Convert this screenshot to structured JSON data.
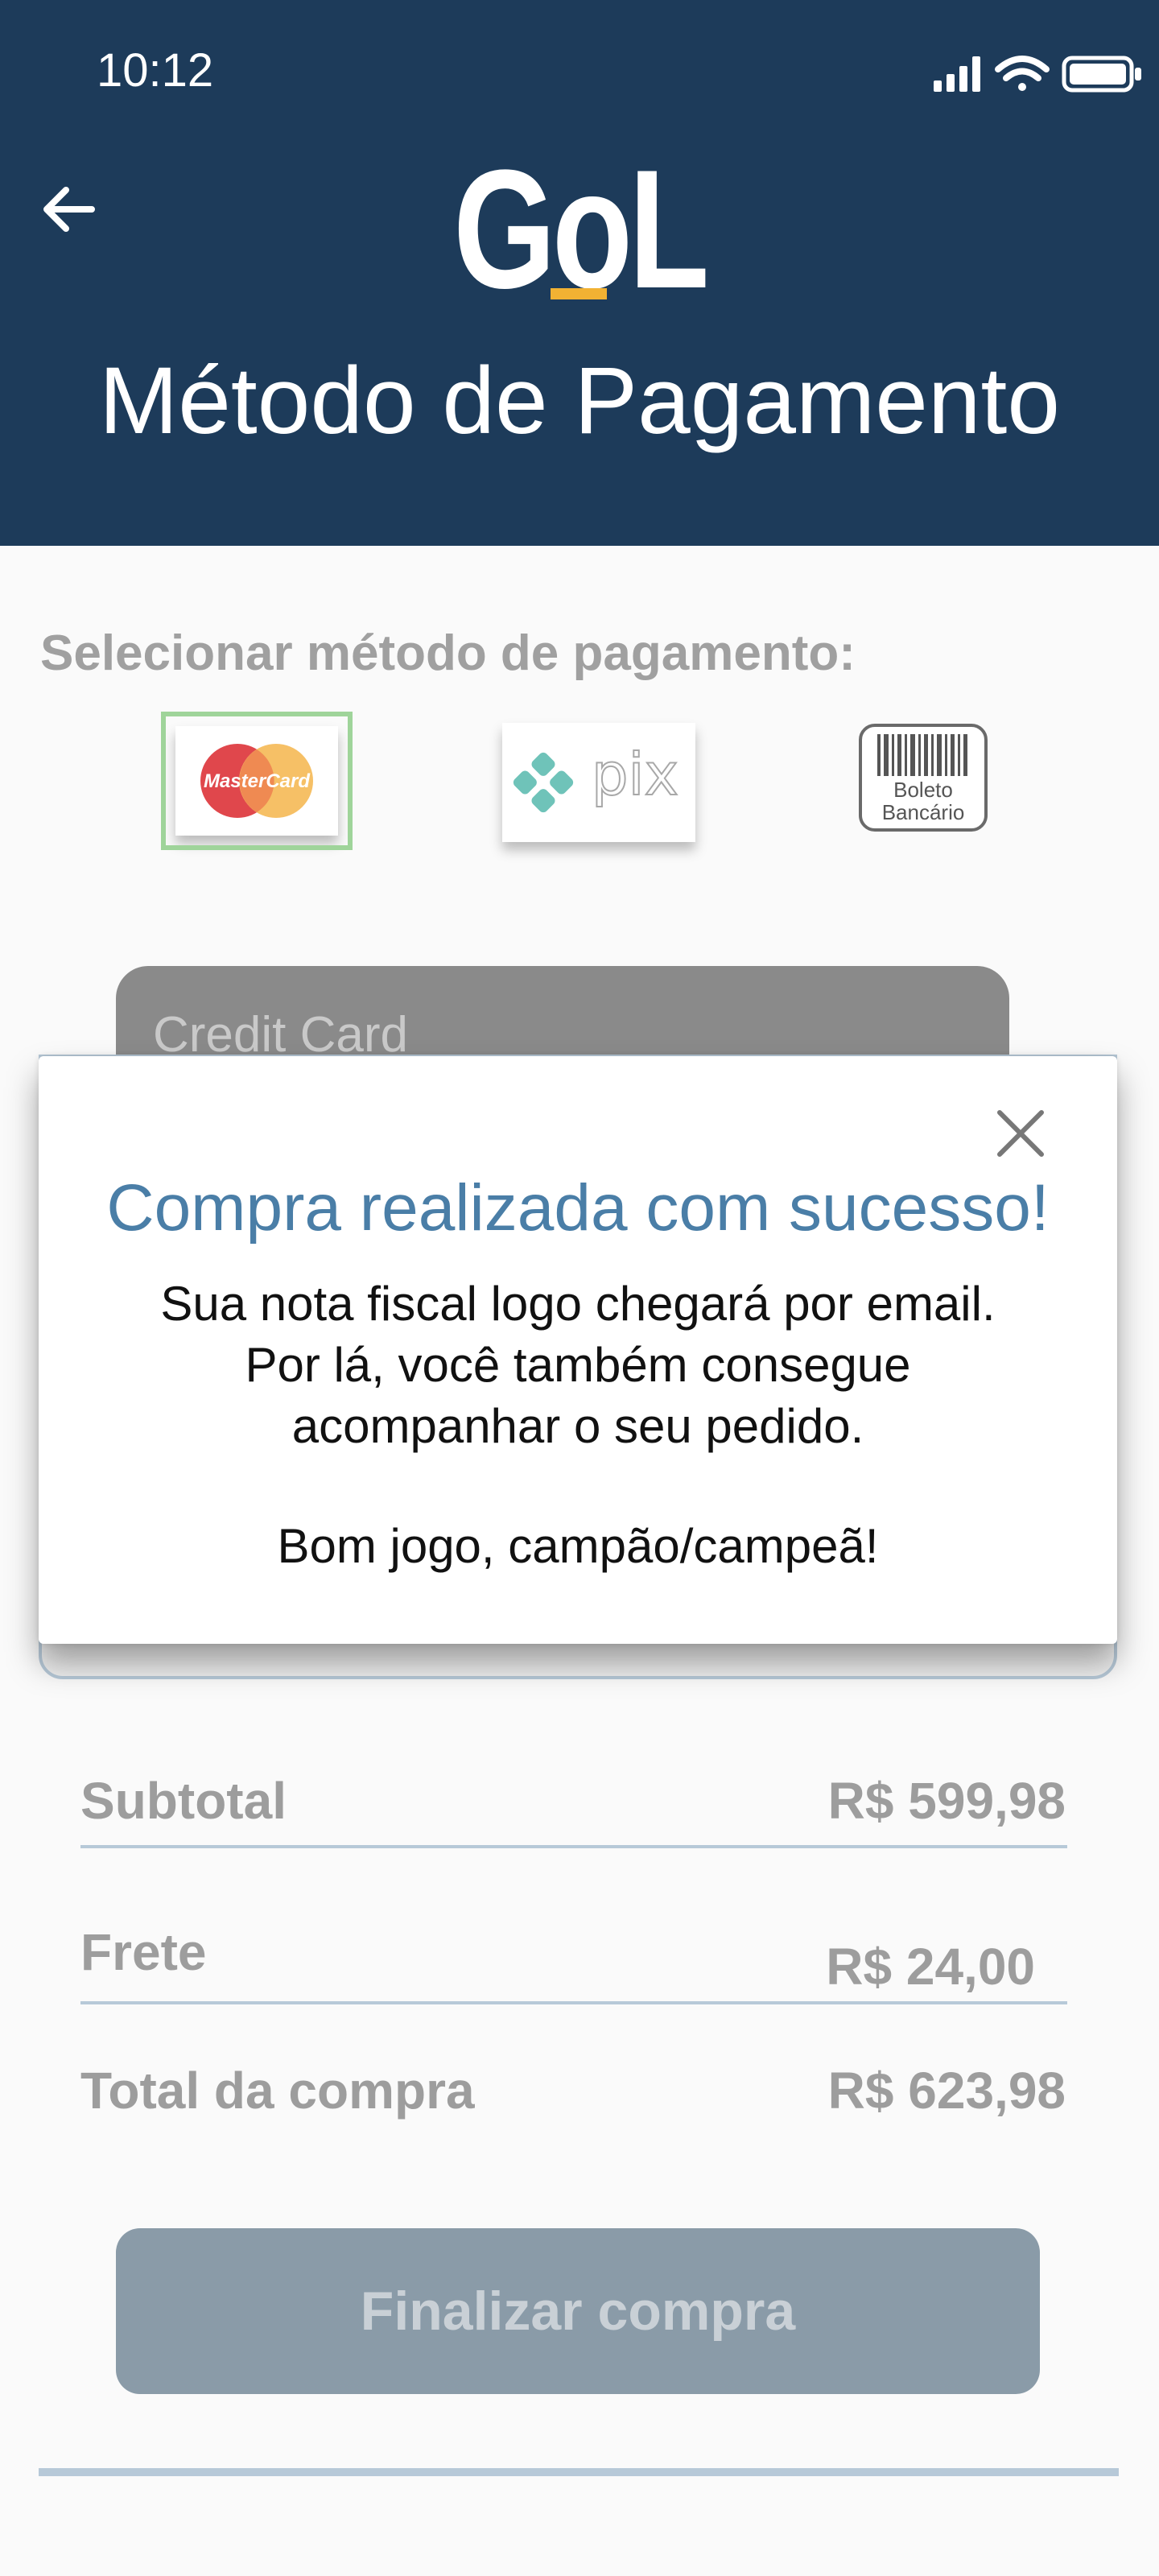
{
  "status_bar": {
    "time": "10:12"
  },
  "header": {
    "logo_text": "GoL",
    "title": "Método de Pagamento",
    "colors": {
      "background": "#1d3b5a",
      "logo_accent": "#f2b233"
    }
  },
  "payment": {
    "select_label": "Selecionar método de pagamento:",
    "methods": [
      {
        "name": "MasterCard",
        "selected": true
      },
      {
        "name": "pix",
        "selected": false
      },
      {
        "name": "Boleto Bancário",
        "line1": "Boleto",
        "line2": "Bancário",
        "selected": false
      }
    ],
    "credit_card_header": "Credit Card"
  },
  "modal": {
    "title": "Compra realizada com sucesso!",
    "line1": "Sua nota fiscal logo chegará por email.",
    "line2": "Por lá, você também consegue",
    "line3": "acompanhar o seu pedido.",
    "closing": "Bom jogo, campão/campeã!"
  },
  "summary": {
    "subtotal_label": "Subtotal",
    "subtotal_value": "R$ 599,98",
    "shipping_label": "Frete",
    "shipping_value": "R$ 24,00",
    "total_label": "Total da compra",
    "total_value": "R$ 623,98"
  },
  "actions": {
    "finalize_label": "Finalizar compra"
  },
  "icons": [
    "back-arrow-icon",
    "signal-icon",
    "wifi-icon",
    "battery-icon",
    "close-icon"
  ]
}
